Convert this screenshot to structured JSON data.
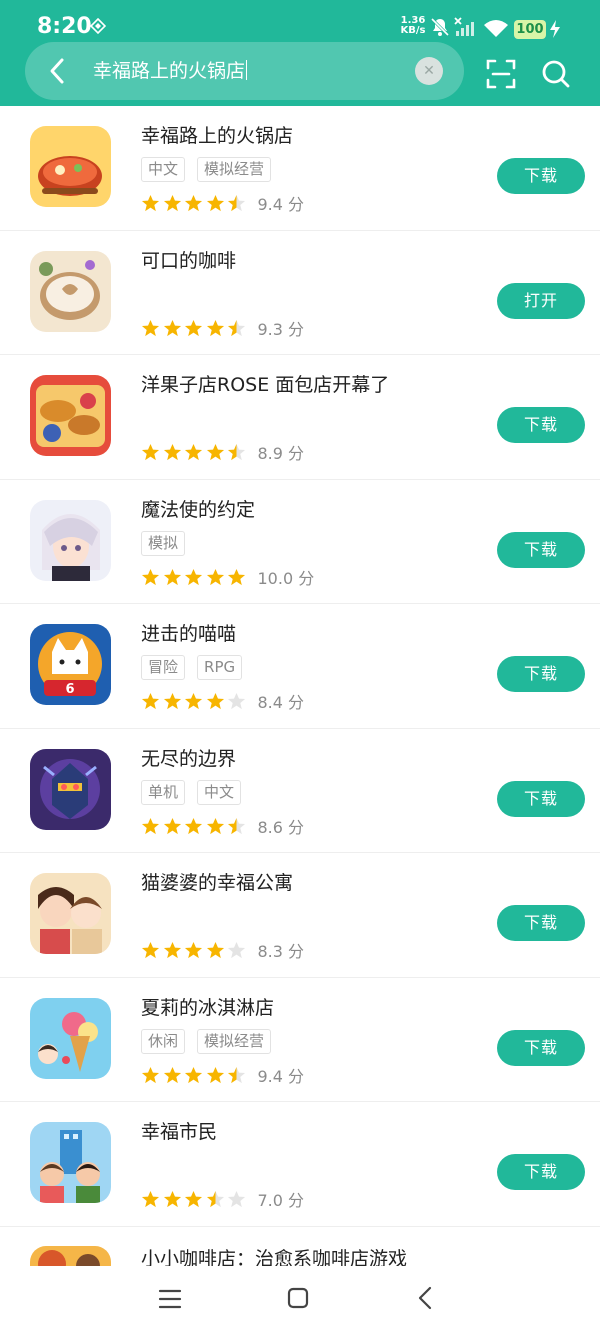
{
  "status_bar": {
    "time": "8:20",
    "net_speed_value": "1.36",
    "net_speed_unit": "KB/s",
    "battery": "100"
  },
  "search": {
    "query": "幸福路上的火锅店",
    "clear_icon": "clear-icon",
    "icons": [
      "back-icon",
      "scan-icon",
      "search-icon"
    ]
  },
  "colors": {
    "brand": "#21b89a",
    "star_filled": "#f7b500",
    "star_empty": "#e4e4e4",
    "battery_bg": "#d8f5a8"
  },
  "apps": [
    {
      "name": "幸福路上的火锅店",
      "tags": [
        "中文",
        "模拟经营"
      ],
      "rating": 4.5,
      "score": "9.4 分",
      "action": "下载",
      "icon": "hotpot-icon"
    },
    {
      "name": "可口的咖啡",
      "tags": [],
      "rating": 4.5,
      "score": "9.3 分",
      "action": "打开",
      "icon": "coffee-icon"
    },
    {
      "name": "洋果子店ROSE 面包店开幕了",
      "tags": [],
      "rating": 4.5,
      "score": "8.9 分",
      "action": "下载",
      "icon": "bread-icon"
    },
    {
      "name": "魔法使的约定",
      "tags": [
        "模拟"
      ],
      "rating": 5,
      "score": "10.0 分",
      "action": "下载",
      "icon": "anime-character-icon"
    },
    {
      "name": "进击的喵喵",
      "tags": [
        "冒险",
        "RPG"
      ],
      "rating": 4,
      "score": "8.4 分",
      "action": "下载",
      "icon": "cat-icon"
    },
    {
      "name": "无尽的边界",
      "tags": [
        "单机",
        "中文"
      ],
      "rating": 4.5,
      "score": "8.6 分",
      "action": "下载",
      "icon": "robot-icon"
    },
    {
      "name": "猫婆婆的幸福公寓",
      "tags": [],
      "rating": 4,
      "score": "8.3 分",
      "action": "下载",
      "icon": "apartment-couple-icon"
    },
    {
      "name": "夏莉的冰淇淋店",
      "tags": [
        "休闲",
        "模拟经营"
      ],
      "rating": 4.5,
      "score": "9.4 分",
      "action": "下载",
      "icon": "ice-cream-icon"
    },
    {
      "name": "幸福市民",
      "tags": [],
      "rating": 3.5,
      "score": "7.0 分",
      "action": "下载",
      "icon": "citizens-icon"
    }
  ],
  "partial_app": {
    "name": "小小咖啡店：治愈系咖啡店游戏",
    "icon": "cafe-icon"
  },
  "nav": [
    "menu-icon",
    "home-icon",
    "back-icon"
  ]
}
